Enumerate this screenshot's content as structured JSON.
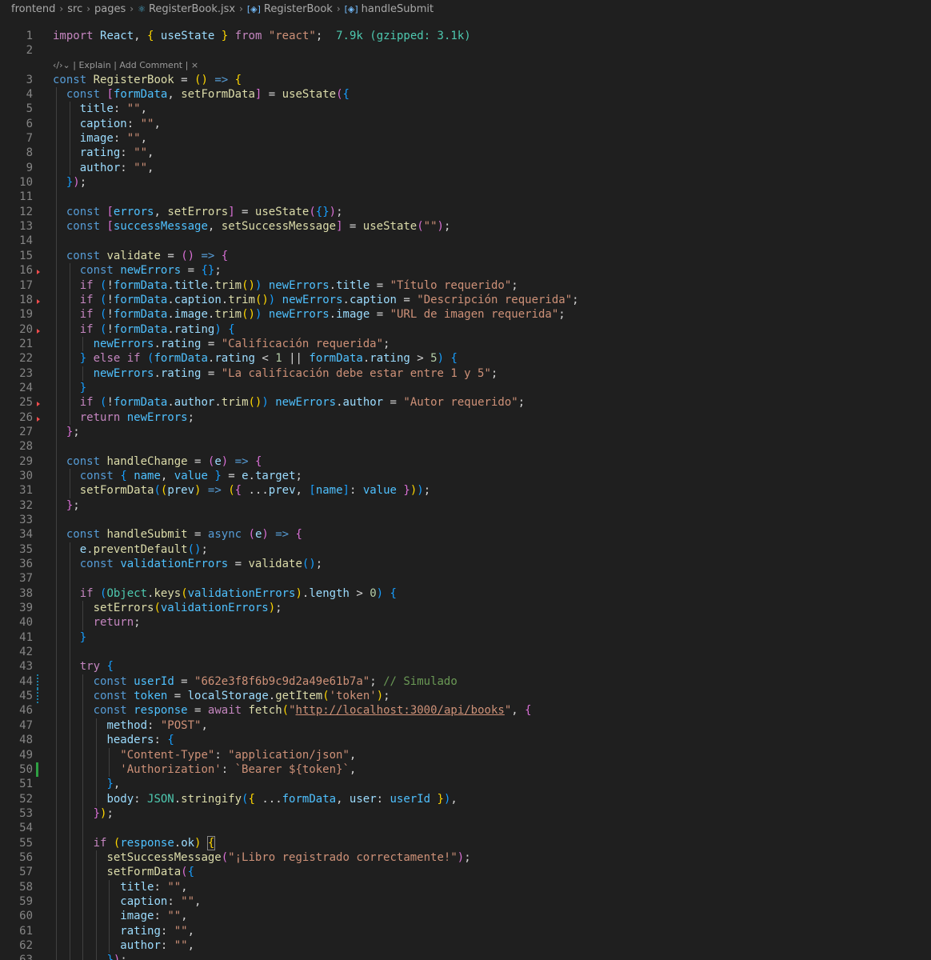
{
  "breadcrumb": {
    "items": [
      "frontend",
      "src",
      "pages",
      "RegisterBook.jsx",
      "RegisterBook",
      "handleSubmit"
    ]
  },
  "codelens": {
    "explain": "Explain",
    "add_comment": "Add Comment",
    "close": "×"
  },
  "import_hint": "7.9k (gzipped: 3.1k)",
  "line_numbers": [
    "1",
    "2",
    "3",
    "4",
    "5",
    "6",
    "7",
    "8",
    "9",
    "10",
    "11",
    "12",
    "13",
    "14",
    "15",
    "16",
    "17",
    "18",
    "19",
    "20",
    "21",
    "22",
    "23",
    "24",
    "25",
    "26",
    "27",
    "28",
    "29",
    "30",
    "31",
    "32",
    "33",
    "34",
    "35",
    "36",
    "37",
    "38",
    "39",
    "40",
    "41",
    "42",
    "43",
    "44",
    "45",
    "46",
    "47",
    "48",
    "49",
    "50",
    "51",
    "52",
    "53",
    "54",
    "55",
    "56",
    "57",
    "58",
    "59",
    "60",
    "61",
    "62",
    "63"
  ],
  "strings": {
    "react": "\"react\"",
    "titulo": "\"Título requerido\"",
    "descripcion": "\"Descripción requerida\"",
    "url_imagen": "\"URL de imagen requerida\"",
    "calificacion": "\"Calificación requerida\"",
    "calificacion_rango": "\"La calificación debe estar entre 1 y 5\"",
    "autor": "\"Autor requerido\"",
    "user_id": "\"662e3f8f6b9c9d2a49e61b7a\"",
    "comment_simulado": "// Simulado",
    "token_key": "'token'",
    "api_url": "http://localhost:3000/api/books",
    "post": "\"POST\"",
    "content_type": "\"Content-Type\"",
    "app_json": "\"application/json\"",
    "authorization": "'Authorization'",
    "bearer": "`Bearer ${token}`",
    "success": "\"¡Libro registrado correctamente!\""
  },
  "colors": {
    "background": "#1f1f1f",
    "keyword": "#569cd6",
    "control": "#c586c0",
    "function": "#dcdcaa",
    "variable": "#9cdcfe",
    "string": "#ce9178",
    "number": "#b5cea8",
    "comment": "#6a9955"
  }
}
